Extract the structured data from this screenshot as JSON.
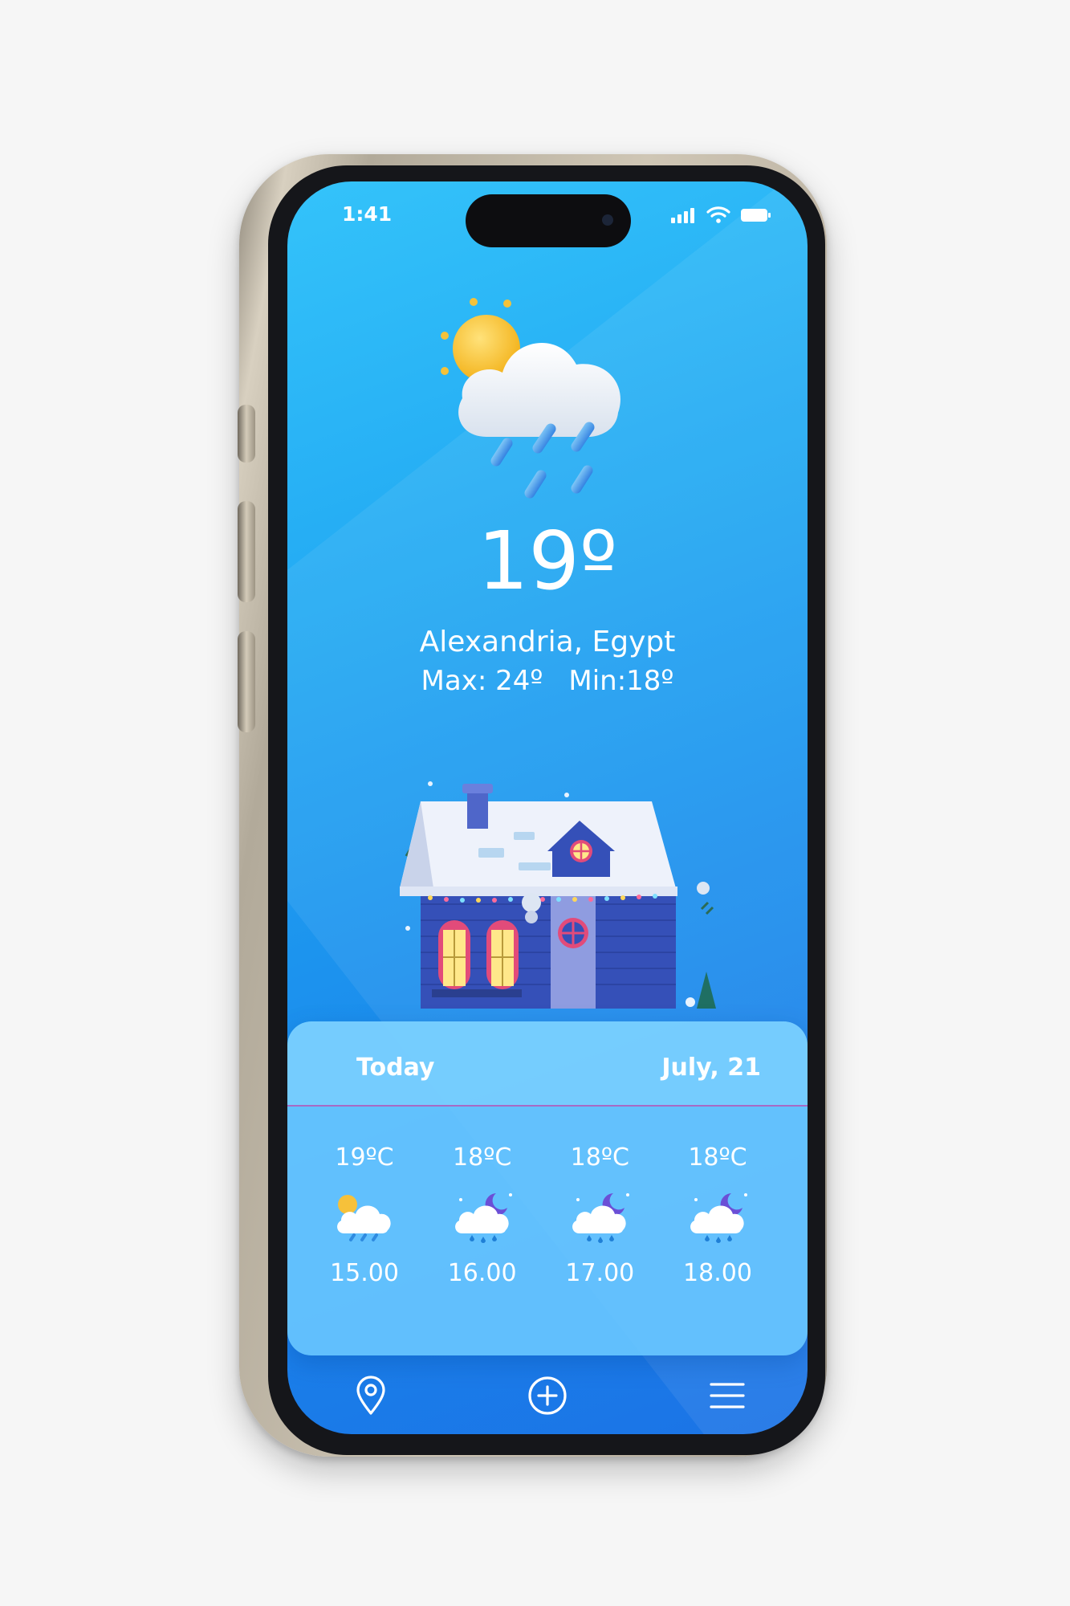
{
  "status_bar": {
    "time": "1:41"
  },
  "current": {
    "temperature": "19º",
    "location": "Alexandria, Egypt",
    "max": "Max: 24º",
    "min": "Min:18º",
    "icon": "sun-cloud-rain-icon"
  },
  "forecast": {
    "title": "Today",
    "date": "July, 21",
    "hours": [
      {
        "temp": "19ºC",
        "time": "15.00",
        "icon": "sun-cloud-rain-icon"
      },
      {
        "temp": "18ºC",
        "time": "16.00",
        "icon": "moon-cloud-rain-icon"
      },
      {
        "temp": "18ºC",
        "time": "17.00",
        "icon": "moon-cloud-rain-icon"
      },
      {
        "temp": "18ºC",
        "time": "18.00",
        "icon": "moon-cloud-rain-icon"
      }
    ]
  },
  "nav": {
    "items": [
      "location-pin-icon",
      "add-circle-icon",
      "menu-icon"
    ]
  },
  "colors": {
    "sky_top": "#34c3fa",
    "sky_bottom": "#1b73e6",
    "card": "#6bc8ff",
    "divider": "#a76ac4"
  }
}
